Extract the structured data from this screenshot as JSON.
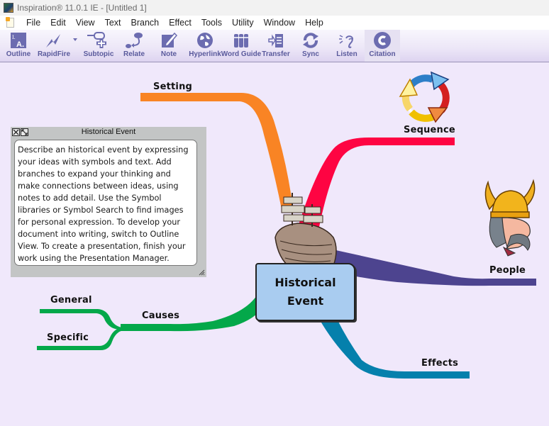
{
  "window": {
    "title": "Inspiration® 11.0.1 IE - [Untitled 1]"
  },
  "menu": [
    "File",
    "Edit",
    "View",
    "Text",
    "Branch",
    "Effect",
    "Tools",
    "Utility",
    "Window",
    "Help"
  ],
  "toolbar": {
    "items": [
      {
        "label": "Outline",
        "icon": "outline-icon"
      },
      {
        "label": "RapidFire",
        "icon": "rapidfire-icon"
      },
      {
        "label": "Subtopic",
        "icon": "subtopic-icon"
      },
      {
        "label": "Relate",
        "icon": "relate-icon"
      },
      {
        "label": "Note",
        "icon": "note-icon"
      },
      {
        "label": "Hyperlink",
        "icon": "hyperlink-globe-icon"
      },
      {
        "label": "Word Guide",
        "icon": "word-guide-books-icon"
      },
      {
        "label": "Transfer",
        "icon": "transfer-icon"
      },
      {
        "label": "Sync",
        "icon": "sync-icon"
      },
      {
        "label": "Listen",
        "icon": "listen-ear-icon"
      },
      {
        "label": "Citation",
        "icon": "citation-icon"
      }
    ]
  },
  "diagram": {
    "main_idea": {
      "line1": "Historical",
      "line2": "Event",
      "symbol": "ship"
    },
    "topics": [
      {
        "label": "Setting",
        "color": "#f98424"
      },
      {
        "label": "Sequence",
        "color": "#fe0442",
        "symbol": "cycle-arrows"
      },
      {
        "label": "People",
        "color": "#4d448f",
        "symbol": "viking"
      },
      {
        "label": "Effects",
        "color": "#0580ac"
      },
      {
        "label": "Causes",
        "color": "#04a84a",
        "subtopics": [
          {
            "label": "General"
          },
          {
            "label": "Specific"
          }
        ]
      }
    ]
  },
  "note": {
    "title": "Historical Event",
    "body": "Describe an historical event by expressing your ideas with symbols and text. Add branches to expand your thinking and make connections between ideas, using notes to add detail. Use the Symbol libraries or Symbol Search to find images for personal expression. To develop your document into writing, switch to Outline View. To create a presentation, finish your work using the Presentation Manager."
  }
}
